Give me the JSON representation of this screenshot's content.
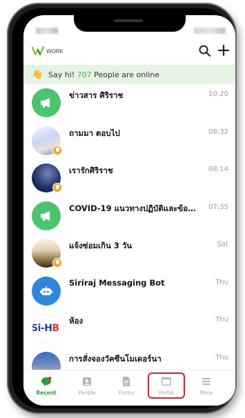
{
  "app": {
    "logo_text": "WORK",
    "online_banner": {
      "prefix": "Say hi!",
      "count": "707",
      "suffix": "People are online"
    }
  },
  "chats": [
    {
      "name": "ข่าวสาร ศิริราช",
      "time": "10:20",
      "avatar": "megaphone-icon"
    },
    {
      "name": "ถามมา ตอบไป",
      "time": "08:32",
      "avatar": "group-photo"
    },
    {
      "name": "เรารักศิริราช",
      "time": "08:14",
      "avatar": "group-photo"
    },
    {
      "name": "COVID-19 แนวทางปฏิบัติและข้อมู...",
      "time": "07:35",
      "avatar": "megaphone-icon"
    },
    {
      "name": "แจ้งซ่อมเกิน 3 วัน",
      "time": "Sat",
      "avatar": "group-photo"
    },
    {
      "name": "Siriraj Messaging Bot",
      "time": "Thu",
      "avatar": "bot-icon"
    },
    {
      "name": "ห้อง",
      "time": "Thu",
      "avatar": "Si-HB",
      "avatar_text": "Si-H",
      "avatar_text_accent": "B"
    },
    {
      "name": "การสั่งจองวัคซีนโมเดอร์นา",
      "time": "Thu",
      "avatar": "group-photo"
    }
  ],
  "nav": [
    {
      "label": "Recent",
      "icon": "chat-bubble-icon",
      "active": true
    },
    {
      "label": "People",
      "icon": "contact-card-icon",
      "active": false
    },
    {
      "label": "Forms",
      "icon": "document-icon",
      "active": false
    },
    {
      "label": "Portal",
      "icon": "browser-window-icon",
      "active": false
    },
    {
      "label": "More",
      "icon": "menu-icon",
      "active": false
    }
  ],
  "colors": {
    "accent": "#39b24a",
    "highlight": "#c0282d",
    "banner_bg": "#e6f4e3"
  }
}
